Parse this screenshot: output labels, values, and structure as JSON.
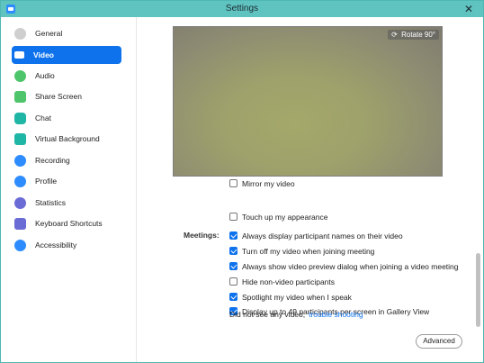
{
  "window": {
    "title": "Settings",
    "close_glyph": "✕"
  },
  "sidebar": {
    "items": [
      {
        "label": "General",
        "icon": "gear-icon",
        "color": "#9b9b9b"
      },
      {
        "label": "Video",
        "icon": "video-camera-icon",
        "color": "#ffffff",
        "active": true
      },
      {
        "label": "Audio",
        "icon": "headphones-icon",
        "color": "#4fc56b"
      },
      {
        "label": "Share Screen",
        "icon": "share-screen-icon",
        "color": "#4fc56b"
      },
      {
        "label": "Chat",
        "icon": "chat-icon",
        "color": "#1fb6a6"
      },
      {
        "label": "Virtual Background",
        "icon": "virtual-background-icon",
        "color": "#1fb6a6"
      },
      {
        "label": "Recording",
        "icon": "recording-icon",
        "color": "#2d8cff"
      },
      {
        "label": "Profile",
        "icon": "profile-icon",
        "color": "#2d8cff"
      },
      {
        "label": "Statistics",
        "icon": "statistics-icon",
        "color": "#6b6bd6"
      },
      {
        "label": "Keyboard Shortcuts",
        "icon": "keyboard-icon",
        "color": "#6b6bd6"
      },
      {
        "label": "Accessibility",
        "icon": "accessibility-icon",
        "color": "#2d8cff"
      }
    ]
  },
  "video": {
    "rotate_label": "Rotate 90°",
    "partial_row": {
      "label": "Mirror my video",
      "checked": false
    },
    "touch_up": {
      "label": "Touch up my appearance",
      "checked": false
    },
    "meetings_label": "Meetings:",
    "meeting_options": [
      {
        "label": "Always display participant names on their video",
        "checked": true
      },
      {
        "label": "Turn off my video when joining meeting",
        "checked": true
      },
      {
        "label": "Always show video preview dialog when joining a video meeting",
        "checked": true
      },
      {
        "label": "Hide non-video participants",
        "checked": false
      },
      {
        "label": "Spotlight my video when I speak",
        "checked": true
      },
      {
        "label": "Display up to 49 participants per screen in Gallery View",
        "checked": true
      }
    ],
    "no_video_text": "Did not see any video,",
    "trouble_link": "trouble shooting",
    "advanced_label": "Advanced"
  },
  "colors": {
    "accent": "#0e72ed",
    "titlebar": "#5fc3c0"
  }
}
